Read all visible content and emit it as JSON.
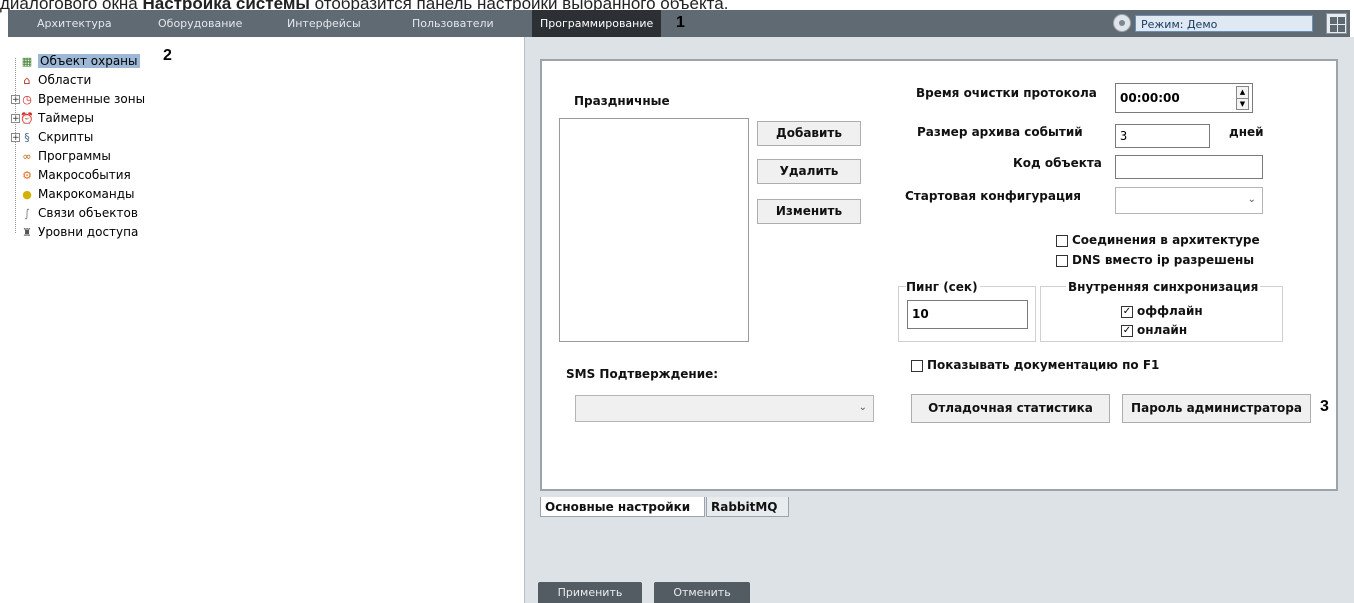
{
  "caption": {
    "prefix": "диалогового окна ",
    "bold": "Настройка системы",
    "suffix": " отобразится панель настройки выбранного объекта."
  },
  "topbar": {
    "tabs": [
      {
        "label": "Архитектура"
      },
      {
        "label": "Оборудование"
      },
      {
        "label": "Интерфейсы"
      },
      {
        "label": "Пользователи"
      },
      {
        "label": "Программирование",
        "active": true
      }
    ],
    "mode_label": "Режим: Демо"
  },
  "markers": [
    "1",
    "2",
    "3"
  ],
  "tree": {
    "items": [
      {
        "label": "Объект охраны",
        "icon": "object-icon",
        "selected": true
      },
      {
        "label": "Области",
        "icon": "house-icon"
      },
      {
        "label": "Временные зоны",
        "icon": "clock-icon",
        "expandable": true
      },
      {
        "label": "Таймеры",
        "icon": "timer-icon",
        "expandable": true
      },
      {
        "label": "Скрипты",
        "icon": "script-icon",
        "expandable": true
      },
      {
        "label": "Программы",
        "icon": "program-icon"
      },
      {
        "label": "Макрособытия",
        "icon": "macro-event-icon"
      },
      {
        "label": "Макрокоманды",
        "icon": "macro-command-icon"
      },
      {
        "label": "Связи объектов",
        "icon": "link-icon"
      },
      {
        "label": "Уровни доступа",
        "icon": "access-level-icon"
      }
    ]
  },
  "settings": {
    "holidays_label": "Праздничные",
    "add_label": "Добавить",
    "delete_label": "Удалить",
    "edit_label": "Изменить",
    "log_clear_time_label": "Время очистки протокола",
    "log_clear_time_value": "00:00:00",
    "archive_size_label": "Размер архива событий",
    "archive_size_value": "3",
    "archive_size_unit": "дней",
    "object_code_label": "Код объекта",
    "object_code_value": "",
    "startup_config_label": "Стартовая конфигурация",
    "startup_config_value": "",
    "arch_connections_label": "Соединения в архитектуре",
    "arch_connections_checked": false,
    "dns_label": "DNS вместо ip разрешены",
    "dns_checked": false,
    "ping_label": "Пинг (сек)",
    "ping_value": "10",
    "sync_label": "Внутренняя синхронизация",
    "sync_offline_label": "оффлайн",
    "sync_offline_checked": true,
    "sync_online_label": "онлайн",
    "sync_online_checked": true,
    "sms_label": "SMS Подтверждение:",
    "sms_value": "",
    "show_docs_label": "Показывать документацию по F1",
    "show_docs_checked": false,
    "debug_stats_label": "Отладочная статистика",
    "admin_password_label": "Пароль администратора"
  },
  "tabs": [
    {
      "label": "Основные настройки",
      "active": true
    },
    {
      "label": "RabbitMQ",
      "active": false
    }
  ],
  "footer": {
    "apply_label": "Применить",
    "cancel_label": "Отменить"
  }
}
